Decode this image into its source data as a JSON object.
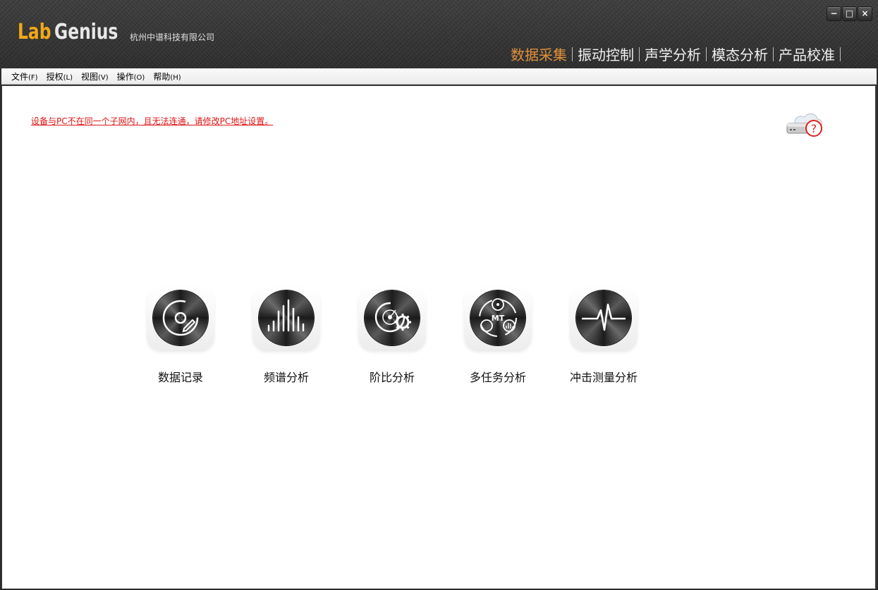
{
  "app": {
    "logo_lab": "Lab",
    "logo_genius": "Genius",
    "company": "杭州中谱科技有限公司",
    "accent_color": "#e0913a",
    "logo_color": "#f2a818"
  },
  "window_controls": {
    "minimize": "−",
    "maximize": "□",
    "close": "×"
  },
  "nav": {
    "items": [
      {
        "label": "数据采集",
        "active": true
      },
      {
        "label": "振动控制",
        "active": false
      },
      {
        "label": "声学分析",
        "active": false
      },
      {
        "label": "模态分析",
        "active": false
      },
      {
        "label": "产品校准",
        "active": false
      }
    ]
  },
  "menu": {
    "items": [
      {
        "label": "文件",
        "acc": "(F)"
      },
      {
        "label": "授权",
        "acc": "(L)"
      },
      {
        "label": "视图",
        "acc": "(V)"
      },
      {
        "label": "操作",
        "acc": "(O)"
      },
      {
        "label": "帮助",
        "acc": "(H)"
      }
    ]
  },
  "main": {
    "warning": "设备与PC不在同一个子网内，且无法连通，请修改PC地址设置。",
    "warning_color": "#e01515",
    "help_icon": "device-help-icon",
    "modules": [
      {
        "label": "数据记录",
        "icon": "data-record-icon"
      },
      {
        "label": "频谱分析",
        "icon": "spectrum-icon"
      },
      {
        "label": "阶比分析",
        "icon": "order-analysis-icon"
      },
      {
        "label": "多任务分析",
        "icon": "multitask-icon",
        "icon_text": "MT"
      },
      {
        "label": "冲击测量分析",
        "icon": "shock-icon"
      }
    ]
  }
}
